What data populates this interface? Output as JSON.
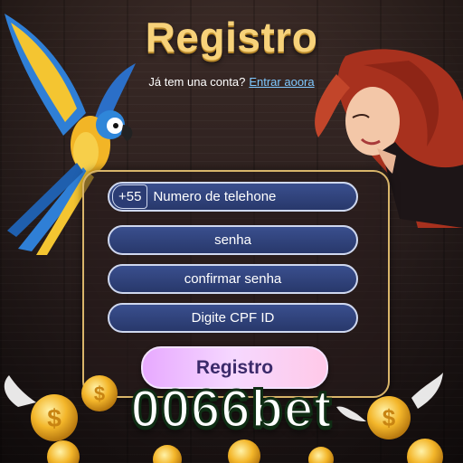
{
  "header": {
    "title": "Registro",
    "account_question": "Já tem una conta?",
    "login_link": "Entrar aoora"
  },
  "form": {
    "phone_prefix": "+55",
    "phone_placeholder": "Numero de telehone",
    "password_placeholder": "senha",
    "confirm_placeholder": "confirmar senha",
    "cpf_placeholder": "Digite CPF ID",
    "submit_label": "Registro"
  },
  "brand": {
    "name": "0066bet"
  },
  "colors": {
    "title_gold": "#f7d27a",
    "panel_border": "#d9b56a",
    "field_blue": "#2f4380",
    "button_pink": "#f6d8ff",
    "link_blue": "#7fc8ff"
  },
  "icons": [
    "parrot-illustration",
    "woman-illustration",
    "winged-coin-icon"
  ]
}
